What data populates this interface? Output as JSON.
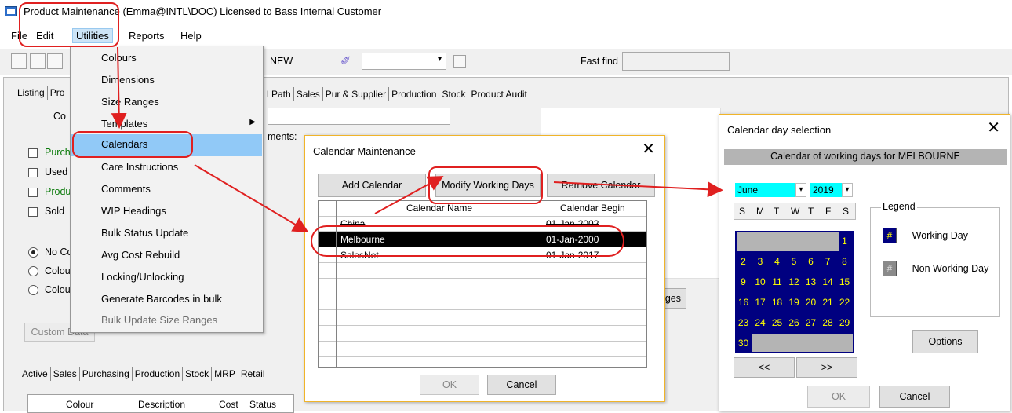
{
  "window_title": "Product Maintenance (Emma@INTL\\DOC) Licensed to Bass Internal Customer",
  "menubar": {
    "file": "File",
    "edit": "Edit",
    "utilities": "Utilities",
    "reports": "Reports",
    "help": "Help"
  },
  "toolbar": {
    "new_label": "NEW",
    "fast_find_label": "Fast find",
    "fast_find_value": ""
  },
  "product_tabs": [
    "Listing",
    "Pro",
    "l Path",
    "Sales",
    "Pur & Supplier",
    "Production",
    "Stock",
    "Product Audit"
  ],
  "background": {
    "code_label": "Co",
    "comments_label": "ments:",
    "checkboxes": [
      "Purch",
      "Used",
      "Produ",
      "Sold"
    ],
    "radios": [
      "No Co",
      "Colou",
      "Colou"
    ],
    "custom_data_button": "Custom Data",
    "ges_button_fragment": "ges",
    "bottom_tabs": [
      "Active",
      "Sales",
      "Purchasing",
      "Production",
      "Stock",
      "MRP",
      "Retail"
    ],
    "bottom_columns": [
      "Colour",
      "Description",
      "Cost",
      "Status"
    ]
  },
  "utilities_menu": [
    {
      "label": "Colours",
      "state": "normal"
    },
    {
      "label": "Dimensions",
      "state": "normal"
    },
    {
      "label": "Size Ranges",
      "state": "normal"
    },
    {
      "label": "Templates",
      "state": "submenu"
    },
    {
      "label": "Calendars",
      "state": "highlighted"
    },
    {
      "label": "Care Instructions",
      "state": "normal"
    },
    {
      "label": "Comments",
      "state": "normal"
    },
    {
      "label": "WIP Headings",
      "state": "normal"
    },
    {
      "label": "Bulk Status Update",
      "state": "normal"
    },
    {
      "label": "Avg Cost Rebuild",
      "state": "normal"
    },
    {
      "label": "Locking/Unlocking",
      "state": "normal"
    },
    {
      "label": "Generate Barcodes in bulk",
      "state": "normal"
    },
    {
      "label": "Bulk Update Size Ranges",
      "state": "disabled"
    }
  ],
  "calendar_maintenance": {
    "title": "Calendar Maintenance",
    "add_button": "Add Calendar",
    "modify_button": "Modify Working Days",
    "remove_button": "Remove Calendar",
    "columns": [
      "Calendar Name",
      "Calendar Begin"
    ],
    "rows": [
      {
        "name": "China",
        "begin": "01-Jan-2002",
        "selected": false
      },
      {
        "name": "Melbourne",
        "begin": "01-Jan-2000",
        "selected": true
      },
      {
        "name": "SalesNet",
        "begin": "01-Jan-2017",
        "selected": false
      }
    ],
    "ok_button": "OK",
    "cancel_button": "Cancel"
  },
  "calendar_day_selection": {
    "title": "Calendar day selection",
    "header": "Calendar of working days for MELBOURNE",
    "month": "June",
    "year": "2019",
    "weekdays": [
      "S",
      "M",
      "T",
      "W",
      "T",
      "F",
      "S"
    ],
    "days": [
      "1",
      "2",
      "3",
      "4",
      "5",
      "6",
      "7",
      "8",
      "9",
      "10",
      "11",
      "12",
      "13",
      "14",
      "15",
      "16",
      "17",
      "18",
      "19",
      "20",
      "21",
      "22",
      "23",
      "24",
      "25",
      "26",
      "27",
      "28",
      "29",
      "30"
    ],
    "legend_title": "Legend",
    "legend_working": "- Working Day",
    "legend_nonworking": "- Non Working Day",
    "legend_symbol": "#",
    "prev_button": "<<",
    "next_button": ">>",
    "options_button": "Options",
    "ok_button": "OK",
    "cancel_button": "Cancel"
  },
  "colors": {
    "highlight": "#91c9f7",
    "calendar_bg": "#000080",
    "calendar_text": "#ffff00",
    "annotation": "#e02020",
    "month_bg": "#00ffff"
  }
}
